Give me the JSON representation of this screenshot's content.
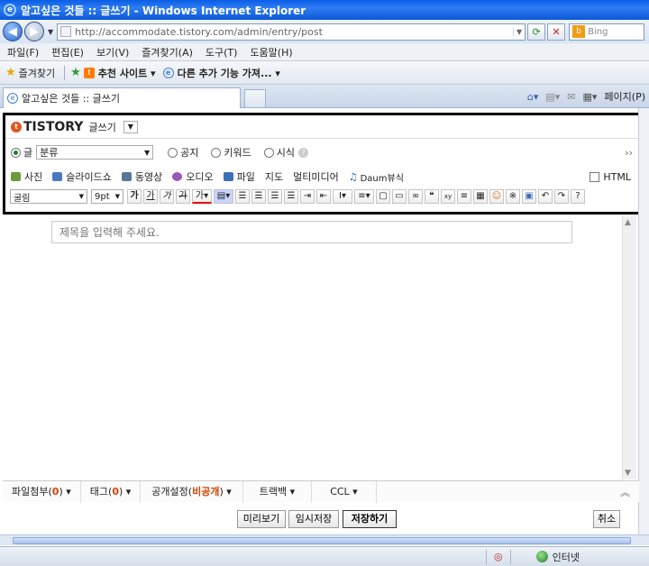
{
  "window": {
    "title": "알고싶은 것들 :: 글쓰기 - Windows Internet Explorer"
  },
  "address": {
    "url": "http://accommodate.tistory.com/admin/entry/post"
  },
  "search": {
    "placeholder": "Bing"
  },
  "menu": [
    "파일(F)",
    "편집(E)",
    "보기(V)",
    "즐겨찾기(A)",
    "도구(T)",
    "도움말(H)"
  ],
  "favorites": {
    "label": "즐겨찾기",
    "item1": "추천 사이트 ▾",
    "item2": "다른 추가 기능 가져... ▾"
  },
  "tab": {
    "title": "알고싶은 것들 :: 글쓰기"
  },
  "browser_tools": {
    "page_label": "페이지(P)"
  },
  "editor": {
    "logo": "TISTORY",
    "mode_label": "글쓰기",
    "post_type_label": "글",
    "category": "분류",
    "radio_notice": "공지",
    "radio_keyword": "키워드",
    "radio_poem": "시식",
    "media": [
      "사진",
      "슬라이드쇼",
      "동영상",
      "오디오",
      "파일",
      "지도",
      "멀티미디어",
      "Daum뷰식"
    ],
    "html_label": "HTML",
    "font": "굴림",
    "font_size": "9pt",
    "title_placeholder": "제목을 입력해 주세요."
  },
  "bottom_tabs": {
    "attach_prefix": "파일첨부(",
    "attach_count": "0",
    "attach_suffix": ")",
    "tag_prefix": "태그(",
    "tag_count": "0",
    "tag_suffix": ")",
    "public_prefix": "공개설정(",
    "public_value": "비공개",
    "public_suffix": ")",
    "trackback": "트랙백",
    "ccl": "CCL"
  },
  "buttons": {
    "preview": "미리보기",
    "temp_save": "임시저장",
    "save": "저장하기",
    "cancel": "취소"
  },
  "status": {
    "zone": "인터넷"
  }
}
